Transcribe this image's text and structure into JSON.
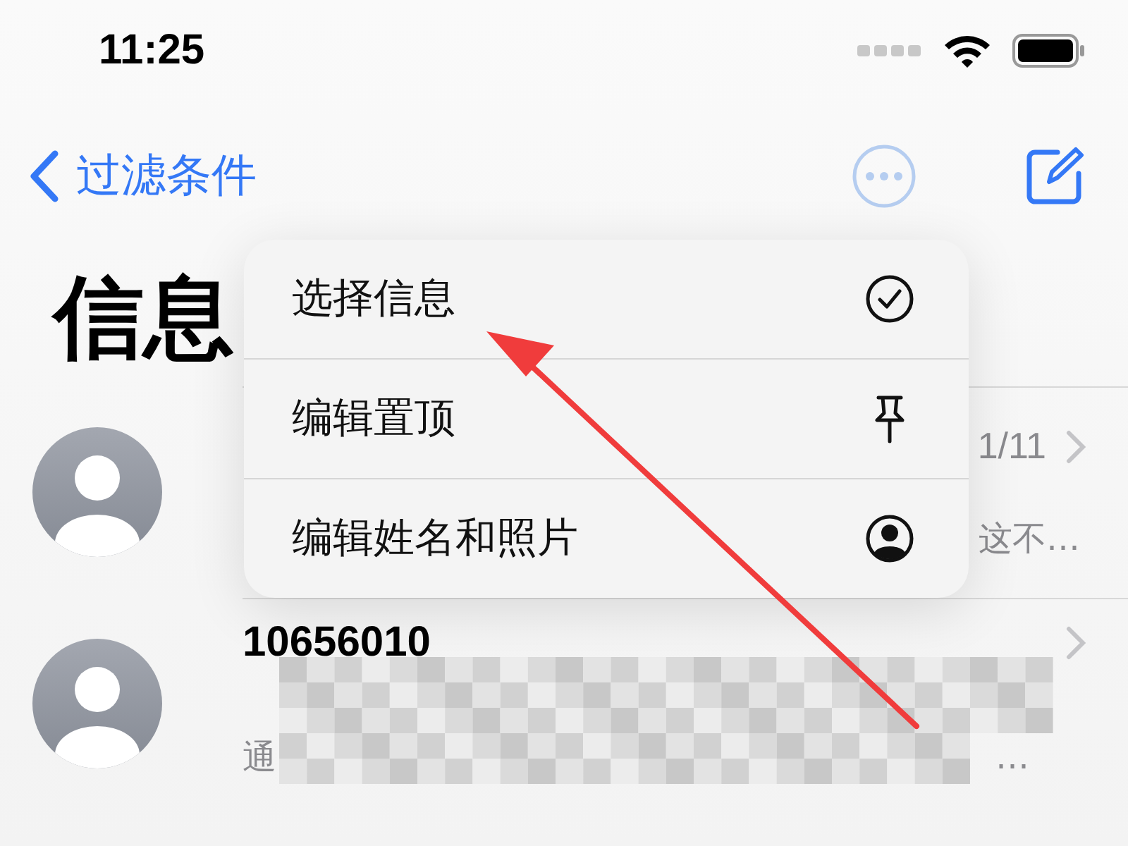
{
  "status_bar": {
    "time": "11:25"
  },
  "nav": {
    "back_label": "过滤条件"
  },
  "title": "信息",
  "conversations": [
    {
      "date": "1/11",
      "preview": "这不…"
    },
    {
      "name": "10656010",
      "preview": "通",
      "preview_tail": "…"
    }
  ],
  "menu": {
    "items": [
      {
        "label": "选择信息"
      },
      {
        "label": "编辑置顶"
      },
      {
        "label": "编辑姓名和照片"
      }
    ]
  }
}
